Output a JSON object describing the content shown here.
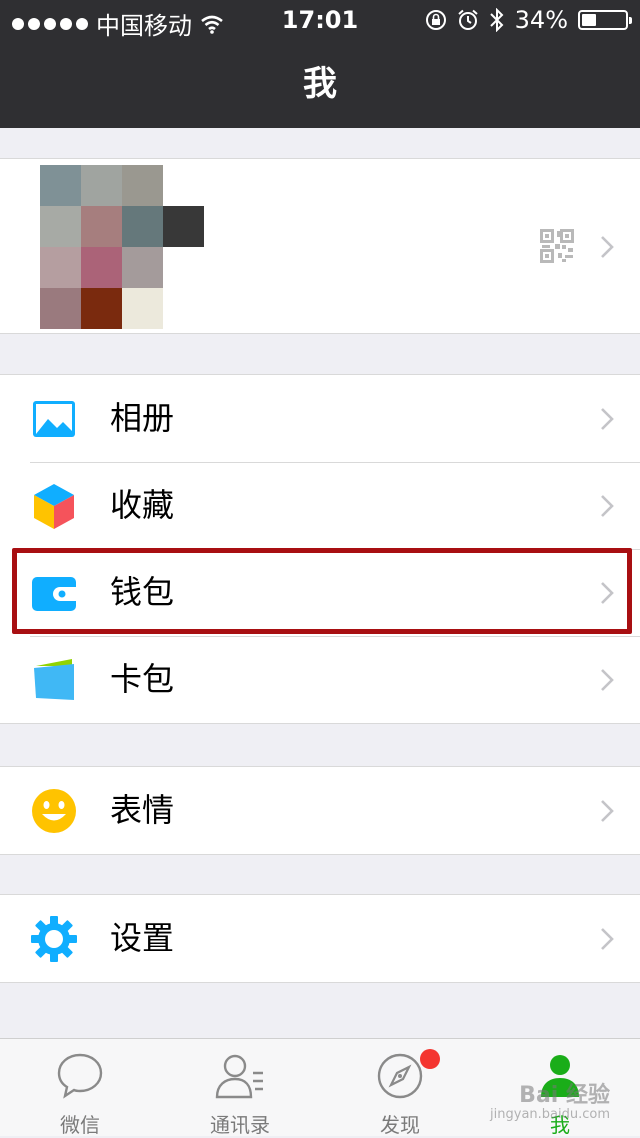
{
  "status_bar": {
    "carrier": "中国移动",
    "time": "17:01",
    "battery_percent": "34%",
    "battery_level": 0.34,
    "icons": [
      "signal-dots-icon",
      "wifi-icon",
      "rotation-lock-icon",
      "alarm-icon",
      "bluetooth-icon",
      "battery-icon"
    ]
  },
  "nav": {
    "title": "我"
  },
  "profile": {
    "avatar_colors": [
      [
        "#7f9196",
        "#a0a4a0",
        "#9a9890",
        null
      ],
      [
        "#a7aaa5",
        "#a67e7e",
        "#65787b",
        "#383838"
      ],
      [
        "#b59ea0",
        "#ab6378",
        "#a49b9b",
        null
      ],
      [
        "#9a7a7e",
        "#7a2a0e",
        "#ece9dc",
        null
      ]
    ],
    "icons": [
      "qr-code-icon",
      "chevron-right-icon"
    ]
  },
  "menu_groups": [
    {
      "items": [
        {
          "label": "相册",
          "icon": "album-icon"
        },
        {
          "label": "收藏",
          "icon": "favorites-icon"
        },
        {
          "label": "钱包",
          "icon": "wallet-icon"
        },
        {
          "label": "卡包",
          "icon": "card-pack-icon"
        }
      ]
    },
    {
      "items": [
        {
          "label": "表情",
          "icon": "sticker-icon"
        }
      ]
    },
    {
      "items": [
        {
          "label": "设置",
          "icon": "settings-icon"
        }
      ]
    }
  ],
  "tabs": [
    {
      "label": "微信",
      "icon": "chat-icon",
      "active": false
    },
    {
      "label": "通讯录",
      "icon": "contacts-icon",
      "active": false
    },
    {
      "label": "发现",
      "icon": "discover-icon",
      "active": false,
      "badge": true
    },
    {
      "label": "我",
      "icon": "me-icon",
      "active": true
    }
  ],
  "watermark": {
    "text": "Bai 经验",
    "subtext": "jingyan.baidu.com"
  },
  "colors": {
    "nav_bg": "#2f2f32",
    "page_bg": "#efeff4",
    "accent_green": "#1aad19",
    "icon_blue": "#10aeff",
    "highlight_red": "#a80f12",
    "badge_red": "#f43530"
  }
}
